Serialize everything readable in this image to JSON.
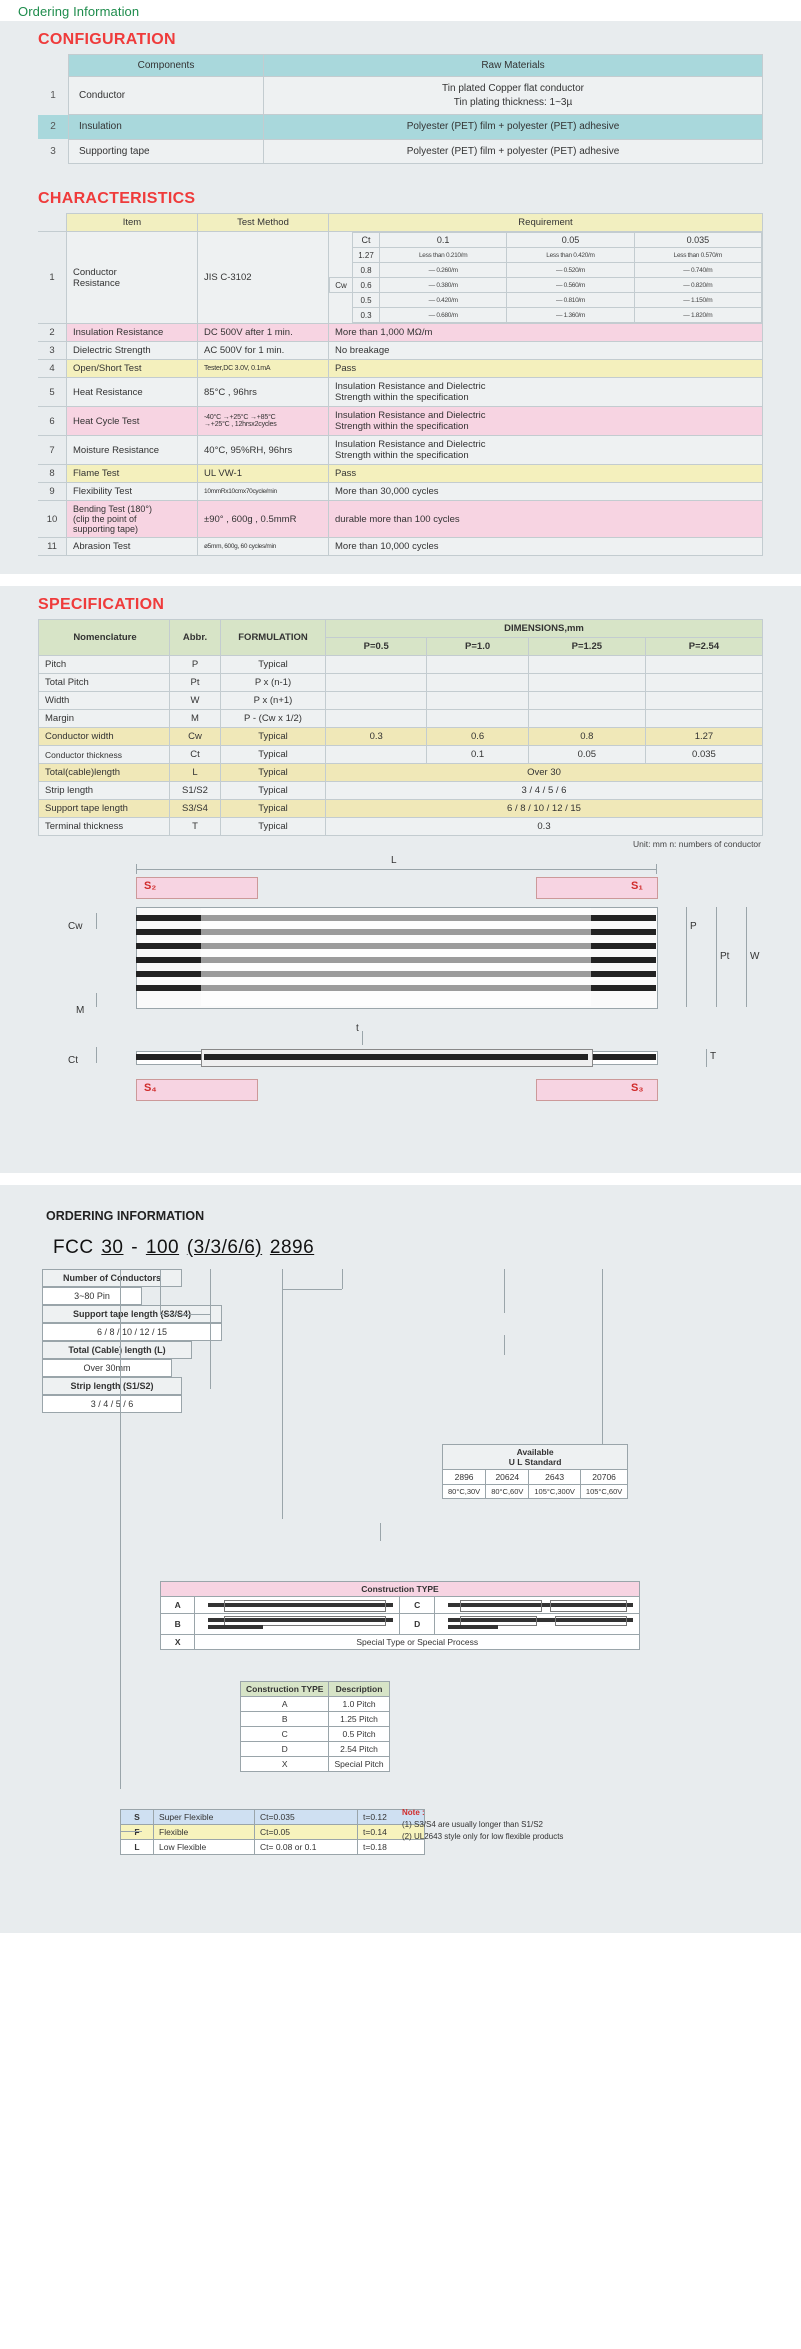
{
  "lead": "Ordering Information",
  "configuration": {
    "title": "CONFIGURATION",
    "headers": [
      "Components",
      "Raw Materials"
    ],
    "rows": [
      {
        "no": "1",
        "component": "Conductor",
        "raw": "Tin plated Copper flat conductor\nTin plating thickness: 1~3µ",
        "highlight": false
      },
      {
        "no": "2",
        "component": "Insulation",
        "raw": "Polyester (PET) film + polyester (PET) adhesive",
        "highlight": true
      },
      {
        "no": "3",
        "component": "Supporting tape",
        "raw": "Polyester (PET) film + polyester (PET) adhesive",
        "highlight": false
      }
    ]
  },
  "characteristics": {
    "title": "CHARACTERISTICS",
    "headers": [
      "Item",
      "Test Method",
      "Requirement"
    ],
    "resistance": {
      "ct_label": "Ct",
      "cw_label": "Cw",
      "ct_values": [
        "0.1",
        "0.05",
        "0.035"
      ],
      "cw_values": [
        "1.27",
        "0.8",
        "0.6",
        "0.5",
        "0.3"
      ],
      "cells": [
        [
          "Less than 0.210/m",
          "Less than 0.420/m",
          "Less than 0.570/m"
        ],
        [
          "— 0.260/m",
          "— 0.520/m",
          "— 0.740/m"
        ],
        [
          "— 0.380/m",
          "— 0.560/m",
          "— 0.820/m"
        ],
        [
          "— 0.420/m",
          "— 0.810/m",
          "— 1.150/m"
        ],
        [
          "— 0.680/m",
          "— 1.360/m",
          "— 1.820/m"
        ]
      ]
    },
    "rows": [
      {
        "no": "1",
        "item": "Conductor\nResistance",
        "method": "JIS C-3102",
        "req": "",
        "style": "plain"
      },
      {
        "no": "2",
        "item": "Insulation Resistance",
        "method": "DC 500V after 1 min.",
        "req": "More than 1,000 MΩ/m",
        "style": "pink"
      },
      {
        "no": "3",
        "item": "Dielectric Strength",
        "method": "AC 500V for 1 min.",
        "req": "No breakage",
        "style": "plain"
      },
      {
        "no": "4",
        "item": "Open/Short Test",
        "method": "Tester,DC 3.0V, 0.1mA",
        "req": "Pass",
        "style": "yell"
      },
      {
        "no": "5",
        "item": "Heat Resistance",
        "method": "85°C , 96hrs",
        "req": "Insulation Resistance and Dielectric\nStrength within the specification",
        "style": "plain"
      },
      {
        "no": "6",
        "item": "Heat Cycle Test",
        "method": "-40°C →+25°C →+85°C\n→+25°C , 12hrsx2cycles",
        "req": "Insulation Resistance and Dielectric\nStrength within the specification",
        "style": "pink"
      },
      {
        "no": "7",
        "item": "Moisture Resistance",
        "method": "40°C, 95%RH, 96hrs",
        "req": "Insulation Resistance and Dielectric\nStrength within the specification",
        "style": "plain"
      },
      {
        "no": "8",
        "item": "Flame Test",
        "method": "UL VW-1",
        "req": "Pass",
        "style": "yell"
      },
      {
        "no": "9",
        "item": "Flexibility Test",
        "method": "10mmRx10cmx70cycle/min",
        "req": "More than 30,000 cycles",
        "style": "plain"
      },
      {
        "no": "10",
        "item": "Bending Test (180°)\n(clip the point of\nsupporting tape)",
        "method": "±90° , 600g , 0.5mmR",
        "req": "durable more than 100 cycles",
        "style": "pink"
      },
      {
        "no": "11",
        "item": "Abrasion Test",
        "method": "ø5mm, 600g, 60 cycles/min",
        "req": "More than 10,000 cycles",
        "style": "plain"
      }
    ]
  },
  "specification": {
    "title": "SPECIFICATION",
    "headers": [
      "Nomenclature",
      "Abbr.",
      "FORMULATION"
    ],
    "dim_header": "DIMENSIONS,mm",
    "pitch_headers": [
      "P=0.5",
      "P=1.0",
      "P=1.25",
      "P=2.54"
    ],
    "unit_note": "Unit: mm     n: numbers of conductor",
    "rows": [
      {
        "nom": "Pitch",
        "abbr": "P",
        "form": "Typical",
        "cells": [
          "",
          "",
          "",
          ""
        ],
        "span": null,
        "style": "w"
      },
      {
        "nom": "Total Pitch",
        "abbr": "Pt",
        "form": "P x (n-1)",
        "cells": [
          "",
          "",
          "",
          ""
        ],
        "span": null,
        "style": "w"
      },
      {
        "nom": "Width",
        "abbr": "W",
        "form": "P x (n+1)",
        "cells": [
          "",
          "",
          "",
          ""
        ],
        "span": null,
        "style": "w"
      },
      {
        "nom": "Margin",
        "abbr": "M",
        "form": "P - (Cw x 1/2)",
        "cells": [
          "",
          "",
          "",
          ""
        ],
        "span": null,
        "style": "w"
      },
      {
        "nom": "Conductor width",
        "abbr": "Cw",
        "form": "Typical",
        "cells": [
          "0.3",
          "0.6",
          "0.8",
          "1.27"
        ],
        "span": null,
        "style": "g"
      },
      {
        "nom": "Conductor thickness",
        "abbr": "Ct",
        "form": "Typical",
        "cells": [
          "0.1",
          "0.05",
          "0.035"
        ],
        "span": "ct",
        "style": "w"
      },
      {
        "nom": "Total(cable)length",
        "abbr": "L",
        "form": "Typical",
        "cells": [
          "Over 30"
        ],
        "span": "all",
        "style": "g"
      },
      {
        "nom": "Strip length",
        "abbr": "S1/S2",
        "form": "Typical",
        "cells": [
          "3 / 4 / 5 / 6"
        ],
        "span": "all",
        "style": "w"
      },
      {
        "nom": "Support tape length",
        "abbr": "S3/S4",
        "form": "Typical",
        "cells": [
          "6 / 8 / 10 / 12 / 15"
        ],
        "span": "all",
        "style": "g"
      },
      {
        "nom": "Terminal thickness",
        "abbr": "T",
        "form": "Typical",
        "cells": [
          "0.3"
        ],
        "span": "all",
        "style": "w"
      }
    ]
  },
  "diagram": {
    "labels": {
      "L": "L",
      "S1": "S₁",
      "S2": "S₂",
      "S3": "S₃",
      "S4": "S₄",
      "Cw": "Cw",
      "M": "M",
      "Ct": "Ct",
      "P": "P",
      "Pt": "Pt",
      "W": "W",
      "T": "T",
      "t": "t"
    }
  },
  "ordering": {
    "title": "ORDERING INFORMATION",
    "part_number": [
      "FCC",
      "30",
      "-",
      "100",
      "(3/3/6/6)",
      "2896"
    ],
    "conductors": {
      "label": "Number of Conductors",
      "value": "3~80 Pin"
    },
    "support_tape": {
      "label": "Support tape length (S3/S4)",
      "value": "6 / 8 / 10 / 12 / 15"
    },
    "total_length": {
      "label": "Total (Cable) length (L)",
      "value": "Over 30mm"
    },
    "strip_length": {
      "label": "Strip length (S1/S2)",
      "value": "3 / 4 / 5 / 6"
    },
    "ul": {
      "title": "Available\nU L Standard",
      "codes": [
        "2896",
        "20624",
        "2643",
        "20706"
      ],
      "ratings": [
        "80°C,30V",
        "80°C,60V",
        "105°C,300V",
        "105°C,60V"
      ]
    },
    "construction": {
      "header": "Construction TYPE",
      "left": [
        "A",
        "B",
        "X"
      ],
      "right": [
        "C",
        "D"
      ],
      "special": "Special Type or Special Process"
    },
    "type_table": {
      "headers": [
        "Construction TYPE",
        "Description"
      ],
      "rows": [
        [
          "A",
          "1.0 Pitch"
        ],
        [
          "B",
          "1.25 Pitch"
        ],
        [
          "C",
          "0.5 Pitch"
        ],
        [
          "D",
          "2.54 Pitch"
        ],
        [
          "X",
          "Special Pitch"
        ]
      ]
    },
    "flex_table": [
      {
        "sym": "S",
        "name": "Super Flexible",
        "ct": "Ct=0.035",
        "t": "t=0.12",
        "cls": "s"
      },
      {
        "sym": "F",
        "name": "Flexible",
        "ct": "Ct=0.05",
        "t": "t=0.14",
        "cls": "f"
      },
      {
        "sym": "L",
        "name": "Low Flexible",
        "ct": "Ct= 0.08 or 0.1",
        "t": "t=0.18",
        "cls": "l"
      }
    ],
    "note": {
      "title": "Note :",
      "lines": [
        "(1)  S3/S4 are usually longer than S1/S2",
        "(2)  UL2643 style only for low flexible products"
      ]
    }
  }
}
